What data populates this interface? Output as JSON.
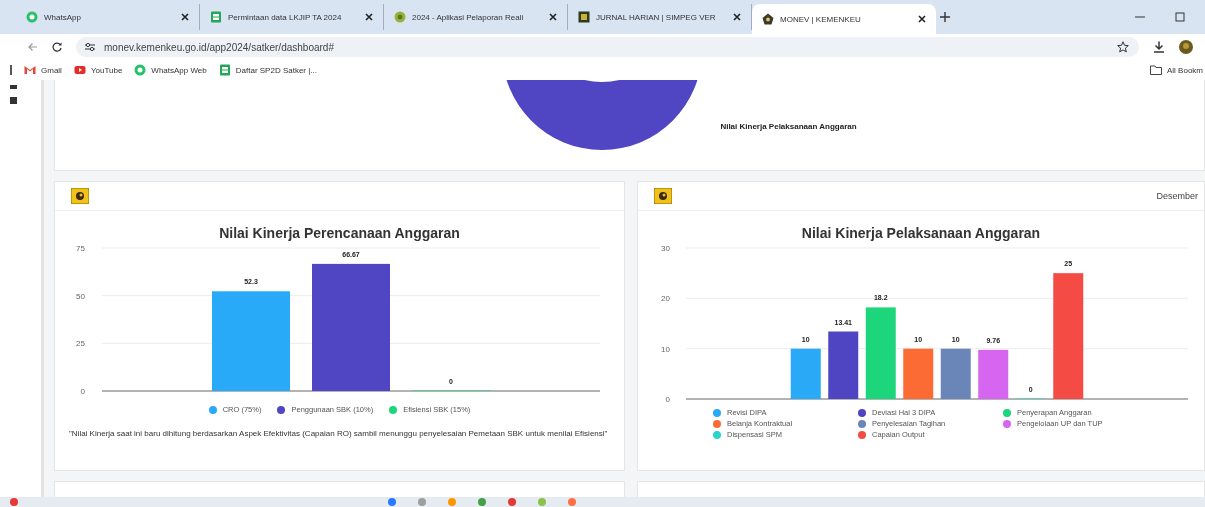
{
  "browser": {
    "tabs": [
      {
        "title": "WhatsApp",
        "selected": false
      },
      {
        "title": "Permintaan data LKJIP TA 2024",
        "selected": false
      },
      {
        "title": "2024 - Aplikasi Pelaporan Reali",
        "selected": false
      },
      {
        "title": "JURNAL HARIAN | SIMPEG VER",
        "selected": false
      },
      {
        "title": "MONEV | KEMENKEU",
        "selected": true
      }
    ],
    "url": "monev.kemenkeu.go.id/app2024/satker/dashboard#",
    "bookmarks": [
      {
        "label": "Gmail"
      },
      {
        "label": "YouTube"
      },
      {
        "label": "WhatsApp Web"
      },
      {
        "label": "Daftar SP2D Satker |..."
      }
    ],
    "all_bookmarks": "All Bookm"
  },
  "top_card": {
    "legend_label": "Nilai Kinerja Pelaksanaan Anggaran"
  },
  "cards": [
    {
      "chart_data": {
        "type": "bar",
        "title": "Nilai Kinerja Perencanaan Anggaran",
        "yticks": [
          0,
          25,
          50,
          75
        ],
        "ylim": [
          0,
          75
        ],
        "data_labels": true,
        "legend": "bottom",
        "series": [
          {
            "name": "CRO (75%)",
            "color": "#29aaf8",
            "values": [
              52.3
            ]
          },
          {
            "name": "Penggunaan SBK (10%)",
            "color": "#5046c4",
            "values": [
              66.67
            ]
          },
          {
            "name": "Efisiensi SBK (15%)",
            "color": "#1ed67a",
            "values": [
              0
            ]
          }
        ]
      },
      "note": "\"Nilai Kinerja saat ini baru dihitung berdasarkan Aspek Efektivitas (Capaian RO) sambil menunggu penyelesaian Pemetaan SBK untuk menilai Efisiensi\""
    },
    {
      "period": "Desember",
      "chart_data": {
        "type": "bar",
        "title": "Nilai Kinerja Pelaksanaan Anggaran",
        "yticks": [
          0,
          10,
          20,
          30
        ],
        "ylim": [
          0,
          30
        ],
        "data_labels": true,
        "legend": "bottom",
        "series": [
          {
            "name": "Revisi DIPA",
            "color": "#2aa9f6",
            "values": [
              10
            ]
          },
          {
            "name": "Deviasi Hal 3 DIPA",
            "color": "#4f45c2",
            "values": [
              13.41
            ]
          },
          {
            "name": "Penyerapan Anggaran",
            "color": "#1dd57a",
            "values": [
              18.2
            ]
          },
          {
            "name": "Belanja Kontraktual",
            "color": "#fd6b35",
            "values": [
              10
            ]
          },
          {
            "name": "Penyelesaian Tagihan",
            "color": "#6a86b9",
            "values": [
              10
            ]
          },
          {
            "name": "Pengelolaan UP dan TUP",
            "color": "#d666f0",
            "values": [
              9.76
            ]
          },
          {
            "name": "Dispensasi SPM",
            "color": "#2dd4cc",
            "values": [
              0
            ]
          },
          {
            "name": "Capaian Output",
            "color": "#f44b45",
            "values": [
              25
            ]
          }
        ]
      }
    }
  ]
}
